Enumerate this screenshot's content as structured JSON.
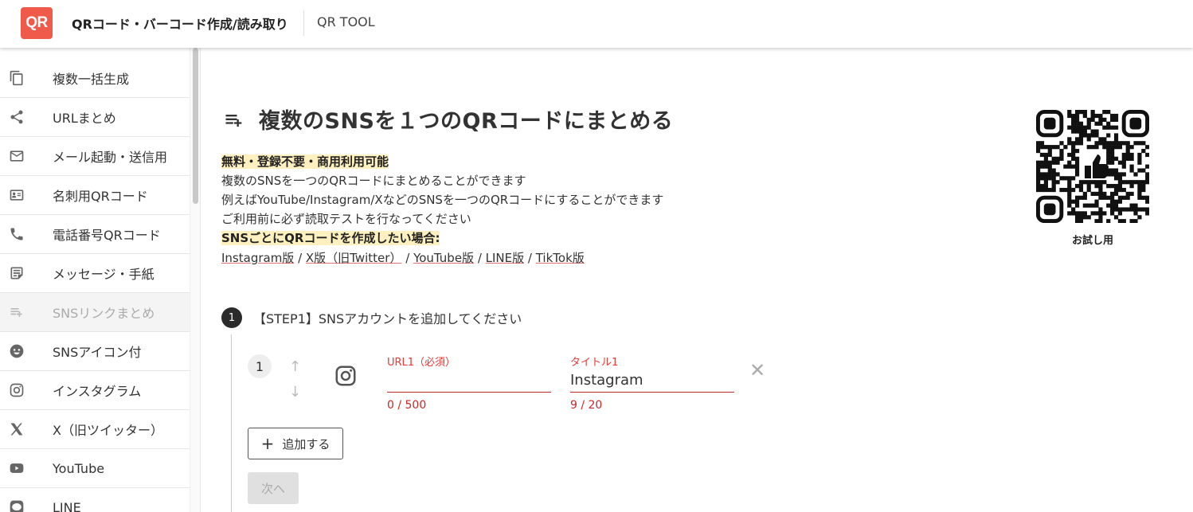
{
  "header": {
    "logo_text": "QR",
    "title": "QRコード・バーコード作成/読み取り",
    "subtitle": "QR TOOL",
    "logo_color": "#f05a4a"
  },
  "sidebar": {
    "items": [
      {
        "label": "複数一括生成",
        "icon": "copy-icon"
      },
      {
        "label": "URLまとめ",
        "icon": "share-icon"
      },
      {
        "label": "メール起動・送信用",
        "icon": "mail-icon"
      },
      {
        "label": "名刺用QRコード",
        "icon": "contact-card-icon"
      },
      {
        "label": "電話番号QRコード",
        "icon": "phone-icon"
      },
      {
        "label": "メッセージ・手紙",
        "icon": "note-icon"
      },
      {
        "label": "SNSリンクまとめ",
        "icon": "playlist-add-icon",
        "active": true
      },
      {
        "label": "SNSアイコン付",
        "icon": "smiley-icon"
      },
      {
        "label": "インスタグラム",
        "icon": "instagram-icon"
      },
      {
        "label": "X（旧ツイッター）",
        "icon": "x-logo-icon"
      },
      {
        "label": "YouTube",
        "icon": "youtube-icon"
      },
      {
        "label": "LINE",
        "icon": "line-icon"
      }
    ]
  },
  "main": {
    "title": "複数のSNSを１つのQRコードにまとめる",
    "highlight1": "無料・登録不要・商用利用可能",
    "desc1": "複数のSNSを一つのQRコードにまとめることができます",
    "desc2": "例えばYouTube/Instagram/XなどのSNSを一つのQRコードにすることができます",
    "desc3": "ご利用前に必ず読取テストを行なってください",
    "highlight2": "SNSごとにQRコードを作成したい場合:",
    "links": [
      {
        "label": "Instagram版"
      },
      {
        "label": "X版（旧Twitter）"
      },
      {
        "label": "YouTube版"
      },
      {
        "label": "LINE版"
      },
      {
        "label": "TikTok版"
      }
    ],
    "link_separator": " / ",
    "qr_caption": "お試し用",
    "step": {
      "number": "1",
      "label": "【STEP1】SNSアカウントを追加してください"
    },
    "row": {
      "index": "1",
      "url_label": "URL1（必須）",
      "url_value": "",
      "url_count": "0 / 500",
      "title_label": "タイトル1",
      "title_value": "Instagram",
      "title_count": "9 / 20",
      "sns_icon": "instagram-icon",
      "remove_glyph": "✕",
      "up_glyph": "↑",
      "down_glyph": "↓"
    },
    "add_button": "追加する",
    "add_glyph": "+",
    "next_button": "次へ"
  }
}
